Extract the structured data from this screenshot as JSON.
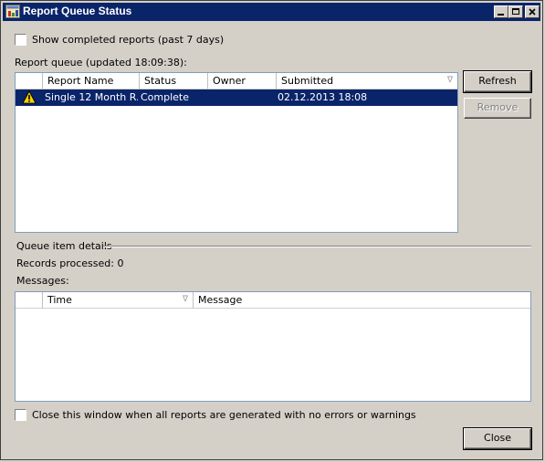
{
  "window": {
    "title": "Report Queue Status"
  },
  "options": {
    "show_completed_label": "Show completed reports (past 7 days)",
    "show_completed_checked": false
  },
  "queue": {
    "label": "Report queue (updated 18:09:38):",
    "columns": [
      "",
      "Report Name",
      "Status",
      "Owner",
      "Submitted"
    ],
    "sort_indicator": "∇",
    "rows": [
      {
        "icon": "warning-icon",
        "report_name": "Single 12 Month R...",
        "status": "Complete",
        "owner": "",
        "submitted": "02.12.2013 18:08",
        "selected": true
      }
    ]
  },
  "buttons": {
    "refresh": "Refresh",
    "remove": "Remove",
    "close": "Close"
  },
  "details": {
    "group_label": "Queue item details",
    "records_processed": "Records processed: 0",
    "messages_label": "Messages:",
    "columns": [
      "",
      "Time",
      "Message"
    ],
    "sort_indicator": "∇"
  },
  "footer": {
    "close_when_done_label": "Close this window when all reports are generated with no errors or warnings",
    "close_when_done_checked": false
  },
  "colors": {
    "titlebar": "#0a246a",
    "selection": "#0a246a",
    "face": "#d4d0c8"
  }
}
